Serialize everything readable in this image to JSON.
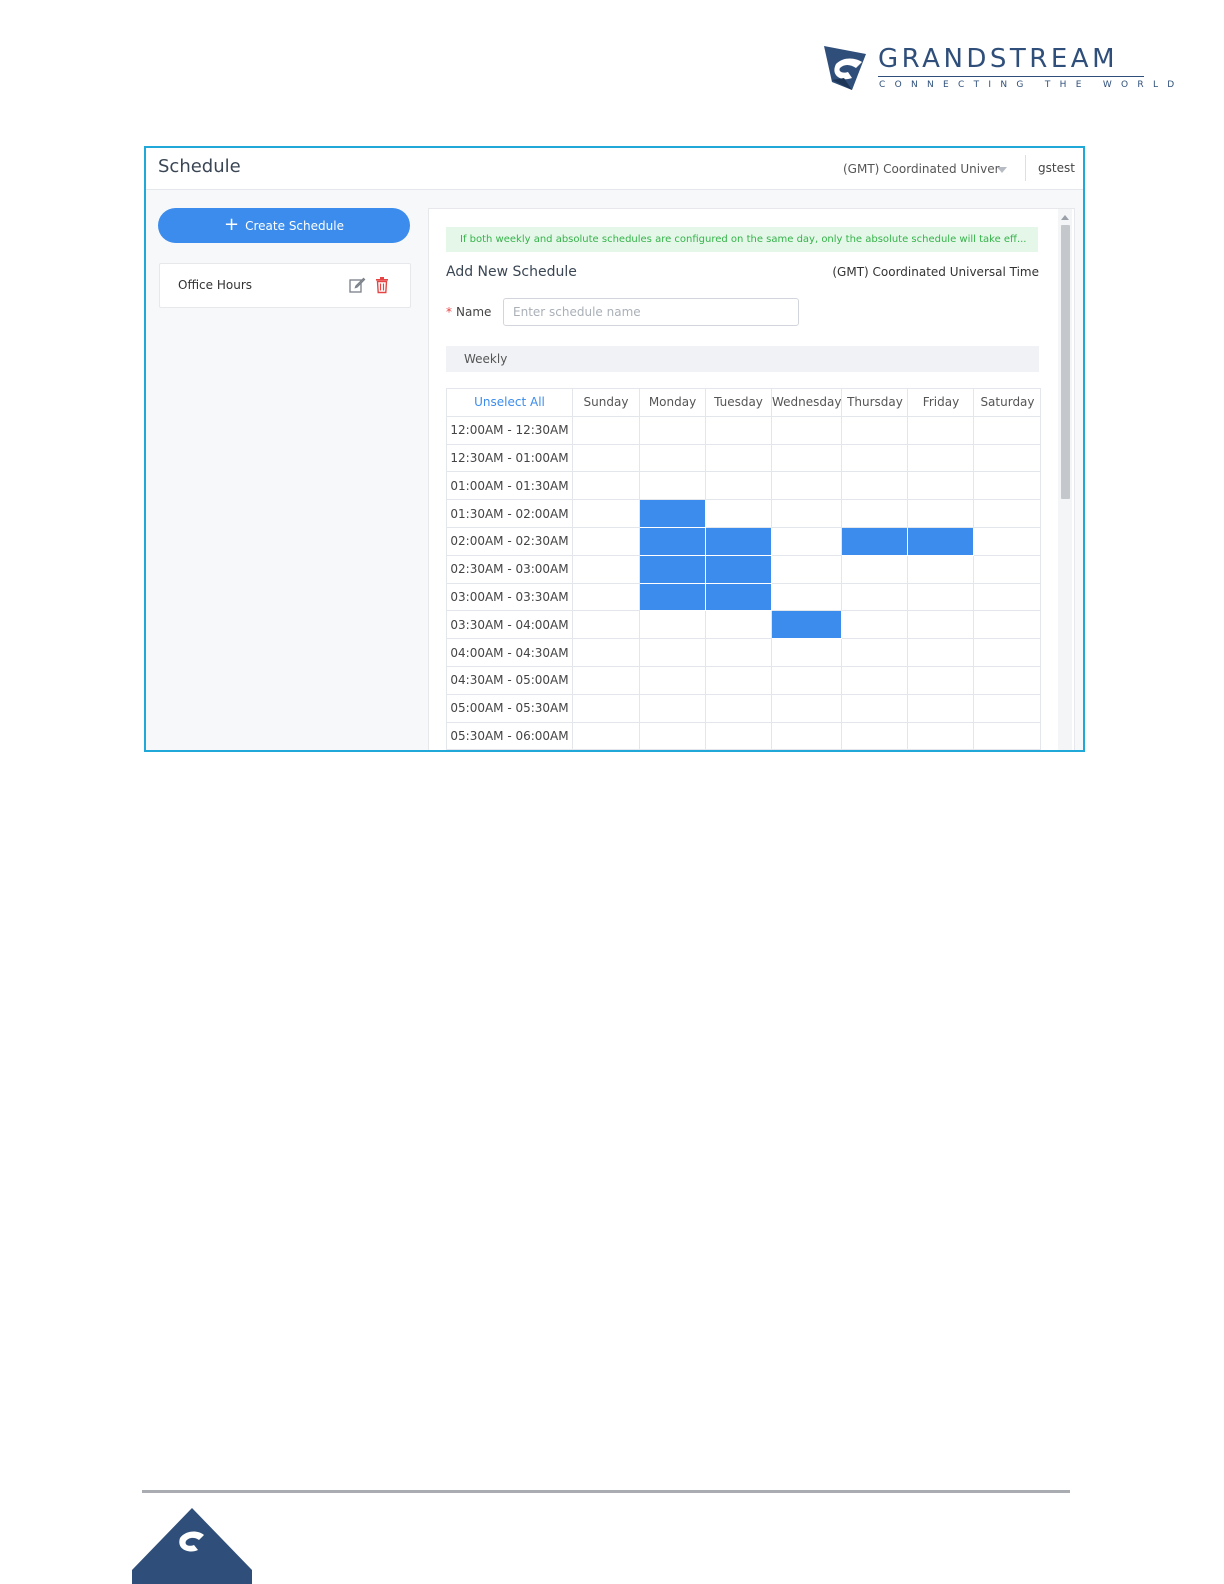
{
  "brand": {
    "name": "GRANDSTREAM",
    "tagline": "CONNECTING THE WORLD",
    "color": "#2f4f7a"
  },
  "topbar": {
    "title": "Schedule",
    "timezone_selected": "(GMT) Coordinated Univer",
    "user": "gstest"
  },
  "sidebar": {
    "create_label": "Create Schedule",
    "items": [
      {
        "label": "Office Hours"
      }
    ]
  },
  "form": {
    "notice": "If both weekly and absolute schedules are configured on the same day, only the absolute schedule will take eff...",
    "title": "Add New Schedule",
    "timezone": "(GMT) Coordinated Universal Time",
    "name_label": "Name",
    "name_required_marker": "*",
    "name_value": "",
    "name_placeholder": "Enter schedule name",
    "section_label": "Weekly"
  },
  "weekly_grid": {
    "unselect_label": "Unselect All",
    "days": [
      "Sunday",
      "Monday",
      "Tuesday",
      "Wednesday",
      "Thursday",
      "Friday",
      "Saturday"
    ],
    "slots": [
      "12:00AM - 12:30AM",
      "12:30AM - 01:00AM",
      "01:00AM - 01:30AM",
      "01:30AM - 02:00AM",
      "02:00AM - 02:30AM",
      "02:30AM - 03:00AM",
      "03:00AM - 03:30AM",
      "03:30AM - 04:00AM",
      "04:00AM - 04:30AM",
      "04:30AM - 05:00AM",
      "05:00AM - 05:30AM",
      "05:30AM - 06:00AM"
    ],
    "selected": [
      [
        0,
        0,
        0,
        0,
        0,
        0,
        0
      ],
      [
        0,
        0,
        0,
        0,
        0,
        0,
        0
      ],
      [
        0,
        0,
        0,
        0,
        0,
        0,
        0
      ],
      [
        0,
        1,
        0,
        0,
        0,
        0,
        0
      ],
      [
        0,
        1,
        1,
        0,
        1,
        1,
        0
      ],
      [
        0,
        1,
        1,
        0,
        0,
        0,
        0
      ],
      [
        0,
        1,
        1,
        0,
        0,
        0,
        0
      ],
      [
        0,
        0,
        0,
        1,
        0,
        0,
        0
      ],
      [
        0,
        0,
        0,
        0,
        0,
        0,
        0
      ],
      [
        0,
        0,
        0,
        0,
        0,
        0,
        0
      ],
      [
        0,
        0,
        0,
        0,
        0,
        0,
        0
      ],
      [
        0,
        0,
        0,
        0,
        0,
        0,
        0
      ]
    ],
    "selected_color": "#3b8cec"
  },
  "colors": {
    "accent": "#3b8cec",
    "frame_border": "#1fa8d8",
    "notice_text": "#35b34a",
    "danger": "#e64545"
  }
}
